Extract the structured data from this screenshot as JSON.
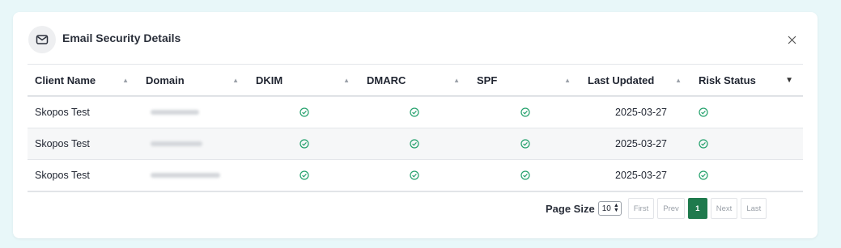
{
  "modal": {
    "title": "Email Security Details",
    "header_icon": "mail-icon",
    "close_icon": "close-icon"
  },
  "table": {
    "columns": [
      {
        "label": "Client Name",
        "sort": "asc"
      },
      {
        "label": "Domain",
        "sort": "asc"
      },
      {
        "label": "DKIM",
        "sort": "asc"
      },
      {
        "label": "DMARC",
        "sort": "asc"
      },
      {
        "label": "SPF",
        "sort": "asc"
      },
      {
        "label": "Last Updated",
        "sort": "asc"
      },
      {
        "label": "Risk Status",
        "sort": "desc"
      }
    ],
    "rows": [
      {
        "client": "Skopos Test",
        "domain": "",
        "dkim": "pass",
        "dmarc": "pass",
        "spf": "pass",
        "updated": "2025-03-27",
        "risk": "pass"
      },
      {
        "client": "Skopos Test",
        "domain": "",
        "dkim": "pass",
        "dmarc": "pass",
        "spf": "pass",
        "updated": "2025-03-27",
        "risk": "pass"
      },
      {
        "client": "Skopos Test",
        "domain": "",
        "dkim": "pass",
        "dmarc": "pass",
        "spf": "pass",
        "updated": "2025-03-27",
        "risk": "pass"
      }
    ]
  },
  "pagination": {
    "page_size_label": "Page Size",
    "page_size_value": "10",
    "first": "First",
    "prev": "Prev",
    "current_page": "1",
    "next": "Next",
    "last": "Last"
  },
  "colors": {
    "background": "#e8f7f9",
    "check_icon": "#22a06b",
    "active_page": "#1f7a4d"
  }
}
